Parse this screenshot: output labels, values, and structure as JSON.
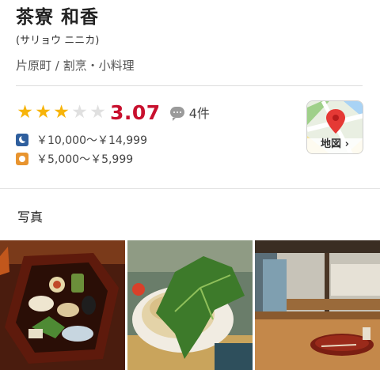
{
  "restaurant": {
    "name": "茶寮 和香",
    "reading": "(サリョウ ニニカ)",
    "area_genre": "片原町 / 割烹・小料理"
  },
  "rating": {
    "stars_filled": 3,
    "stars_total": 5,
    "score": "3.07",
    "review_count": "4件"
  },
  "prices": {
    "dinner": "￥10,000～￥14,999",
    "lunch": "￥5,000～￥5,999"
  },
  "map": {
    "label": "地図 ›"
  },
  "photos": {
    "section_title": "写真",
    "items": [
      "photo-bento",
      "photo-grilled-dish",
      "photo-interior"
    ]
  },
  "colors": {
    "score": "#c8102e",
    "star_on": "#f7b40a",
    "star_off": "#e0e0e0",
    "map_pin": "#e53935"
  }
}
